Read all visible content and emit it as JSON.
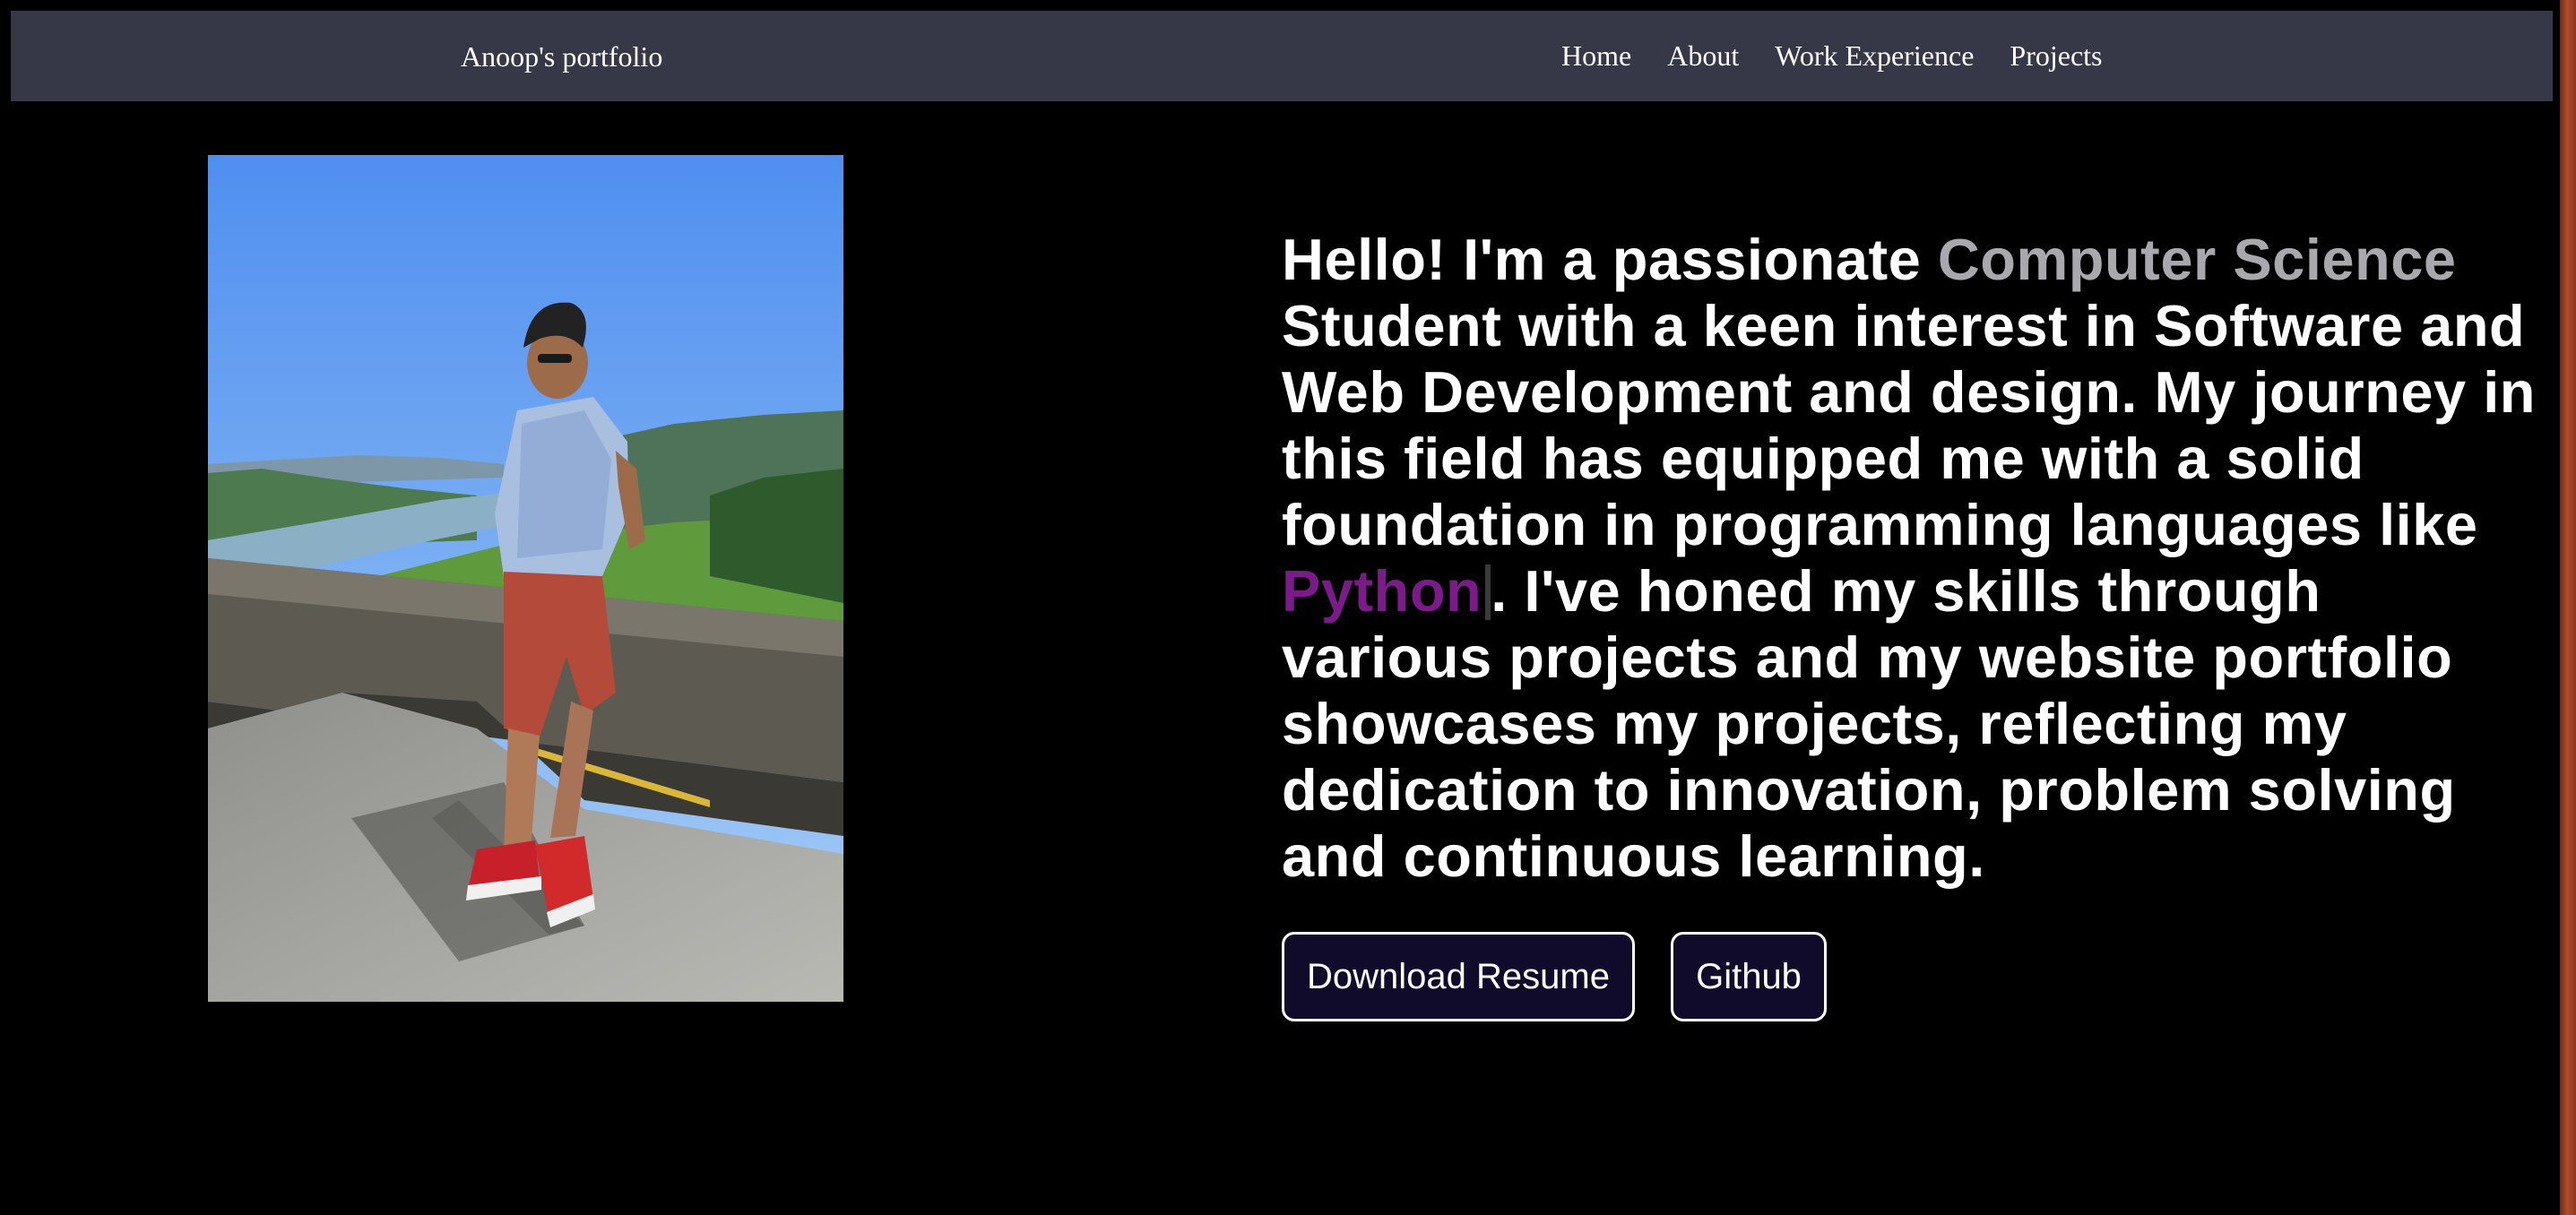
{
  "navbar": {
    "brand": "Anoop's portfolio",
    "links": [
      "Home",
      "About",
      "Work Experience",
      "Projects"
    ]
  },
  "hero": {
    "photo_description": "profile-photo",
    "intro_prefix": "Hello! I'm a passionate ",
    "highlight_1": "Computer Science",
    "intro_middle": " Student with a keen interest in Software and Web Development and design. My journey in this field has equipped me with a solid foundation in programming languages like ",
    "typed_word": "Python",
    "intro_suffix": ". I've honed my skills through various projects and my website portfolio showcases my projects, reflecting my dedication to innovation, problem solving and continuous learning."
  },
  "buttons": {
    "resume_label": "Download Resume",
    "github_label": "Github"
  },
  "colors": {
    "background": "#000000",
    "navbar": "#363847",
    "highlight_grey": "#a8a8ad",
    "highlight_purple": "#7b1b8a",
    "button_bg": "#100a2b"
  }
}
